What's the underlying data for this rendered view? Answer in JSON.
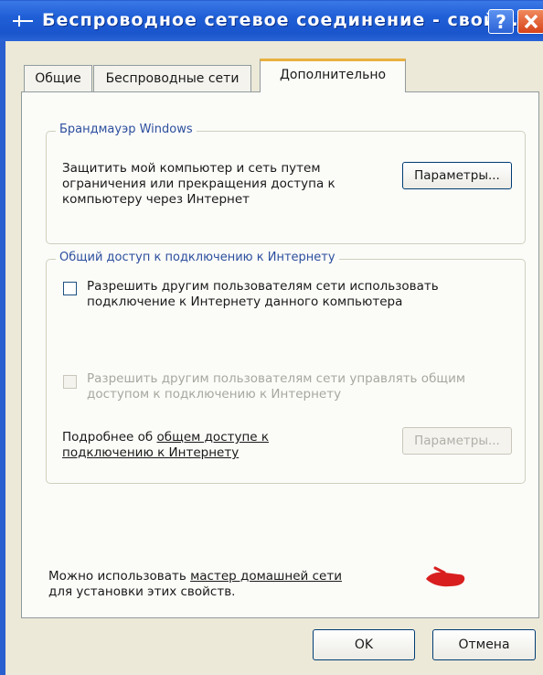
{
  "window": {
    "title": "Беспроводное сетевое соединение - свой...",
    "help_label": "?"
  },
  "tabs": [
    {
      "label": "Общие"
    },
    {
      "label": "Беспроводные сети"
    },
    {
      "label": "Дополнительно",
      "active": true
    }
  ],
  "firewall": {
    "legend": "Брандмауэр Windows",
    "description": "Защитить мой компьютер и сеть путем ограничения или прекращения доступа к компьютеру через Интернет",
    "settings_button": "Параметры..."
  },
  "ics": {
    "legend": "Общий доступ к подключению к Интернету",
    "allow_checkbox_label": "Разрешить другим пользователям сети использовать подключение к Интернету данного компьютера",
    "allow_checked": false,
    "control_checkbox_label": "Разрешить другим пользователям сети управлять общим доступом к подключению к Интернету",
    "control_enabled": false,
    "more_info_prefix": "Подробнее об ",
    "more_info_link": "общем доступе к подключению к Интернету",
    "settings_button": "Параметры..."
  },
  "wizard": {
    "prefix": "Можно использовать ",
    "link": "мастер домашней сети",
    "suffix": "для установки этих свойств."
  },
  "buttons": {
    "ok": "OK",
    "cancel": "Отмена"
  },
  "colors": {
    "titlebar": "#1f5fd6",
    "active_tab_accent": "#e9b13f",
    "annotation_pointer": "#d81e1e"
  }
}
